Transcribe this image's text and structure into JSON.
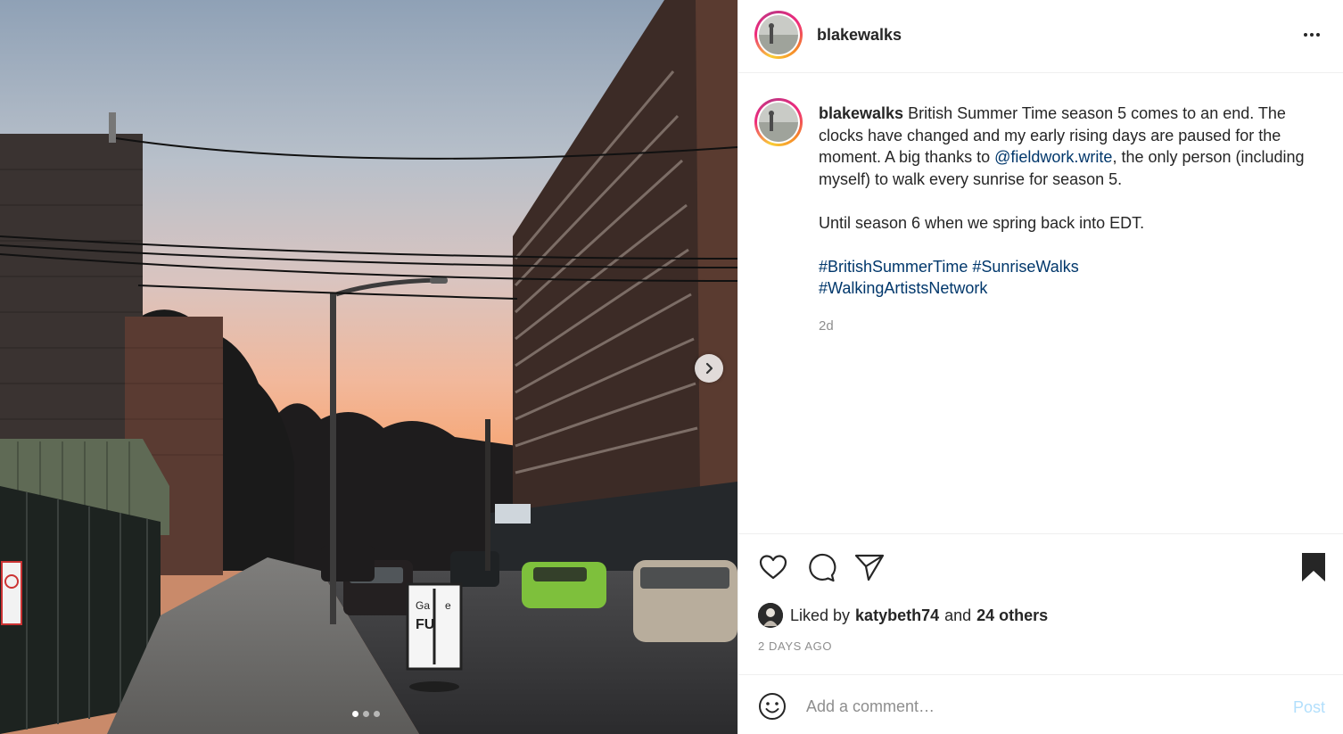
{
  "post": {
    "username": "blakewalks",
    "more_icon": "more-horizontal-icon"
  },
  "caption": {
    "username": "blakewalks",
    "text_1": " British Summer Time season 5 comes to an end. The clocks have changed and my early rising days are paused for the moment. A big thanks to ",
    "mention": "@fieldwork.write",
    "text_2": ", the only person (including myself) to walk every sunrise for season 5.",
    "paragraph_2": "Until season 6 when we spring back into EDT.",
    "hashtags": [
      "#BritishSummerTime",
      "#SunriseWalks",
      "#WalkingArtistsNetwork"
    ],
    "age": "2d"
  },
  "photo": {
    "sign_text_1": "Ga",
    "sign_text_2": "e",
    "sign_text_3": "FU",
    "no_parking_sign": "NO PARKING",
    "carousel_total": 3,
    "carousel_active": 1
  },
  "actions": {
    "like_icon": "heart-icon",
    "comment_icon": "comment-icon",
    "share_icon": "paper-plane-icon",
    "save_icon": "bookmark-icon"
  },
  "likes": {
    "prefix": "Liked by",
    "user": "katybeth74",
    "conjunction": "and",
    "others": "24 others"
  },
  "date_label": "2 DAYS AGO",
  "comment": {
    "placeholder": "Add a comment…",
    "post_label": "Post"
  },
  "colors": {
    "link": "#00376b",
    "muted": "#8e8e8e",
    "post_button_disabled": "#b2dffc",
    "text": "#262626"
  }
}
